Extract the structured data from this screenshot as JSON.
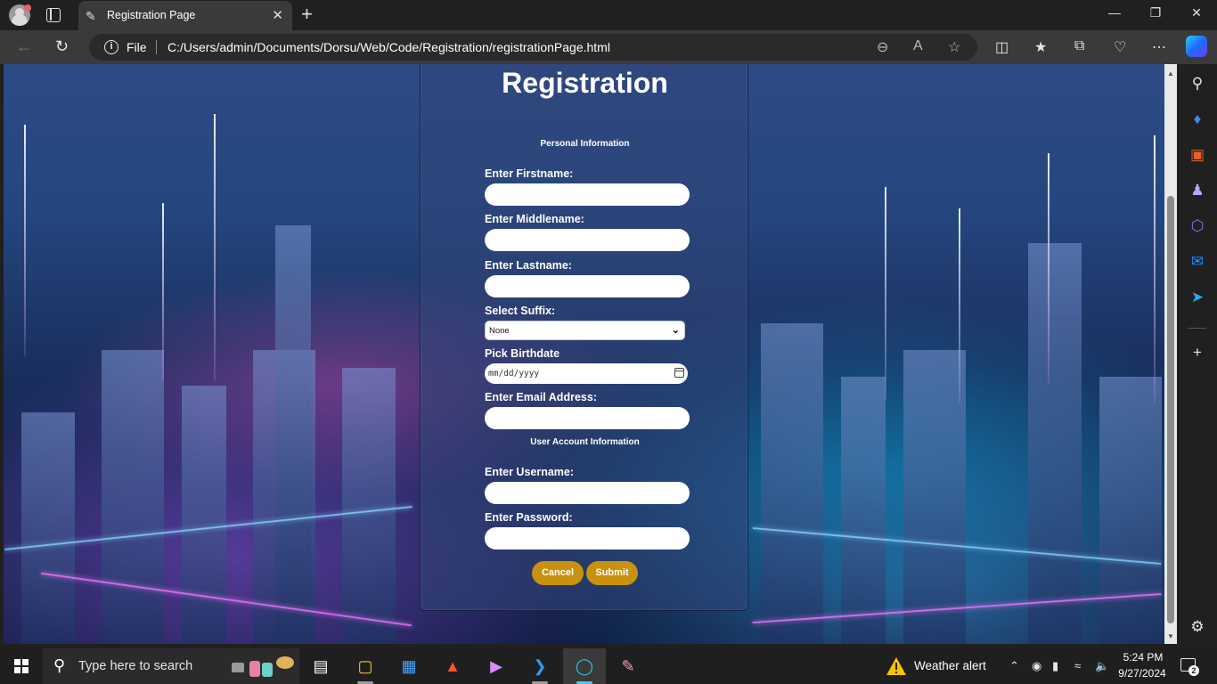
{
  "browser": {
    "tab_title": "Registration Page",
    "address_scheme": "File",
    "url": "C:/Users/admin/Documents/Dorsu/Web/Code/Registration/registrationPage.html"
  },
  "form": {
    "title": "Registration",
    "section_personal": "Personal Information",
    "firstname_label": "Enter Firstname:",
    "middlename_label": "Enter Middlename:",
    "lastname_label": "Enter Lastname:",
    "suffix_label": "Select Suffix:",
    "suffix_value": "None",
    "birthdate_label": "Pick Birthdate",
    "birthdate_placeholder": "mm/dd/yyyy",
    "email_label": "Enter Email Address:",
    "section_account": "User Account Information",
    "username_label": "Enter Username:",
    "password_label": "Enter Password:",
    "cancel_label": "Cancel",
    "submit_label": "Submit",
    "button_color": "#c8920e"
  },
  "taskbar": {
    "search_placeholder": "Type here to search",
    "weather_text": "Weather alert",
    "time": "5:24 PM",
    "date": "9/27/2024",
    "notification_count": "2"
  },
  "icons": {
    "browser": [
      "profile-icon",
      "tab-actions-icon",
      "new-tab-icon",
      "back-icon",
      "refresh-icon",
      "info-icon",
      "zoom-out-icon",
      "read-aloud-icon",
      "favorite-star-icon",
      "split-screen-icon",
      "favorites-icon",
      "collections-icon",
      "browser-essentials-icon",
      "more-icon",
      "copilot-icon"
    ],
    "sidebar": [
      "search-icon",
      "shopping-icon",
      "tools-icon",
      "games-icon",
      "office-icon",
      "outlook-icon",
      "telegram-icon",
      "add-icon",
      "settings-icon"
    ],
    "taskbar": [
      "windows-start-icon",
      "search-icon",
      "task-view-icon",
      "file-explorer-icon",
      "microsoft-store-icon",
      "brave-icon",
      "media-player-icon",
      "vscode-icon",
      "edge-icon",
      "paint-icon",
      "weather-alert-icon",
      "chevron-up-icon",
      "camera-icon",
      "battery-icon",
      "wifi-icon",
      "volume-icon",
      "notifications-icon"
    ]
  }
}
